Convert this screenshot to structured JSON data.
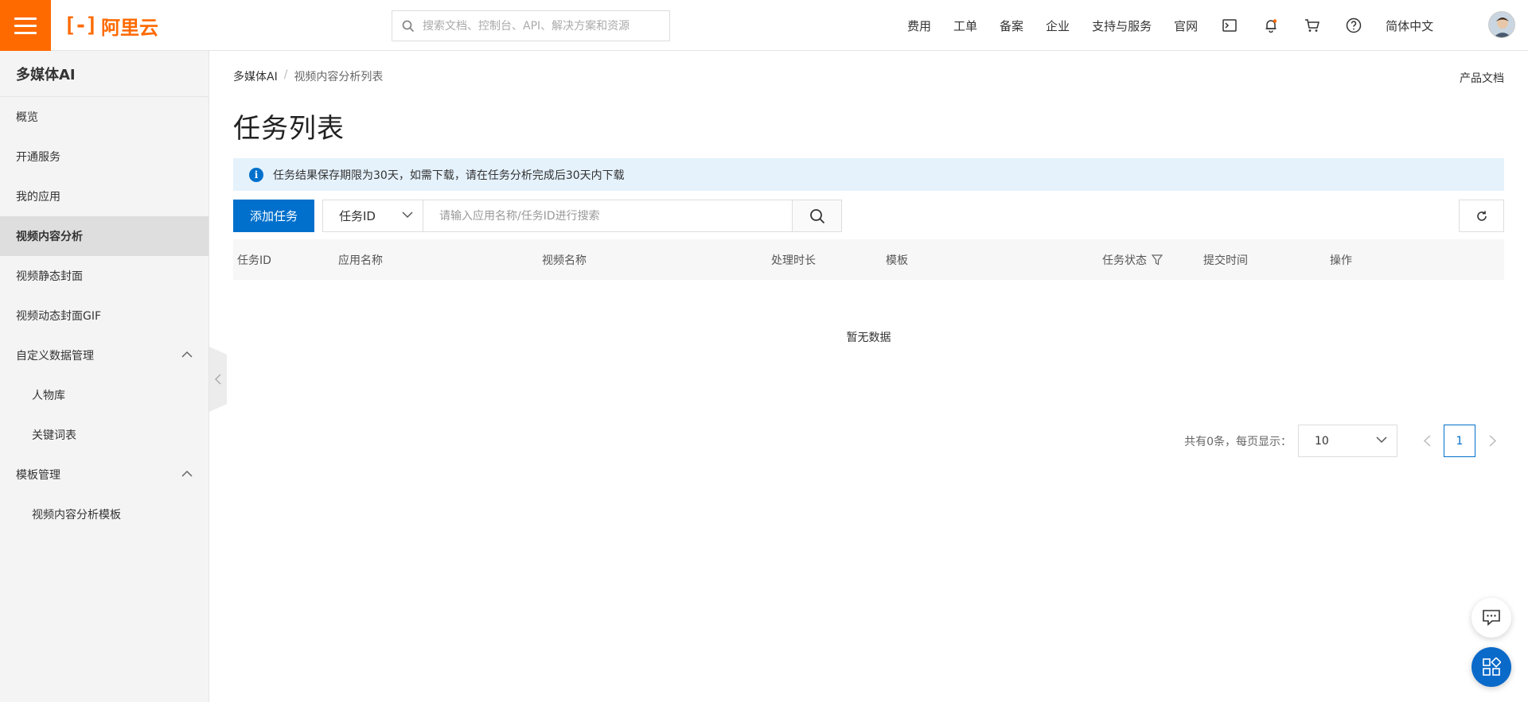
{
  "header": {
    "logo_text": "阿里云",
    "logo_mark": "[-]",
    "search_placeholder": "搜索文档、控制台、API、解决方案和资源",
    "nav": [
      "费用",
      "工单",
      "备案",
      "企业",
      "支持与服务",
      "官网"
    ],
    "language": "简体中文",
    "icons": [
      "terminal-icon",
      "bell-icon",
      "cart-icon",
      "help-icon"
    ]
  },
  "sidebar": {
    "title": "多媒体AI",
    "items": [
      {
        "label": "概览",
        "level": 1
      },
      {
        "label": "开通服务",
        "level": 1
      },
      {
        "label": "我的应用",
        "level": 1
      },
      {
        "label": "视频内容分析",
        "level": 1,
        "active": true
      },
      {
        "label": "视频静态封面",
        "level": 1
      },
      {
        "label": "视频动态封面GIF",
        "level": 1
      },
      {
        "label": "自定义数据管理",
        "level": 1,
        "expandable": true
      },
      {
        "label": "人物库",
        "level": 2
      },
      {
        "label": "关键词表",
        "level": 2
      },
      {
        "label": "模板管理",
        "level": 1,
        "expandable": true
      },
      {
        "label": "视频内容分析模板",
        "level": 2
      }
    ]
  },
  "breadcrumb": {
    "root": "多媒体AI",
    "separator": "/",
    "current": "视频内容分析列表"
  },
  "doc_link": "产品文档",
  "page_title": "任务列表",
  "notice": {
    "icon": "i",
    "text": "任务结果保存期限为30天，如需下载，请在任务分析完成后30天内下载"
  },
  "toolbar": {
    "add_label": "添加任务",
    "filter_selected": "任务ID",
    "search_placeholder": "请输入应用名称/任务ID进行搜索"
  },
  "table": {
    "columns": [
      "任务ID",
      "应用名称",
      "视频名称",
      "处理时长",
      "模板",
      "任务状态",
      "提交时间",
      "操作"
    ],
    "rows": [],
    "empty_text": "暂无数据"
  },
  "pagination": {
    "summary": "共有0条，每页显示：",
    "page_size": "10",
    "current_page": "1"
  },
  "colors": {
    "brand": "#ff6a00",
    "primary": "#0070cc",
    "notice_bg": "#e5f2fc"
  }
}
